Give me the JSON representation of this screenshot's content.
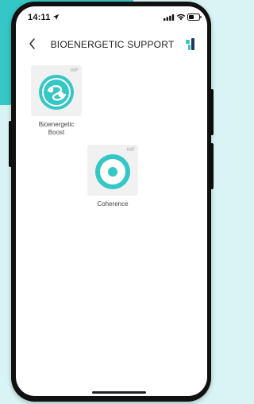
{
  "status_bar": {
    "time": "14:11"
  },
  "header": {
    "title": "BIOENERGETIC SUPPORT"
  },
  "tiles": [
    {
      "badge": "IMF",
      "label_line1": "Bioenergetic",
      "label_line2": "Boost",
      "icon": "swirl-icon"
    },
    {
      "badge": "IMF",
      "label_line1": "Coherence",
      "label_line2": "",
      "icon": "target-dot-icon"
    }
  ],
  "colors": {
    "accent": "#35c6c6",
    "background": "#d9f4f4",
    "tile_background": "#f1f1f1",
    "logo_dark": "#1a3a5a"
  }
}
